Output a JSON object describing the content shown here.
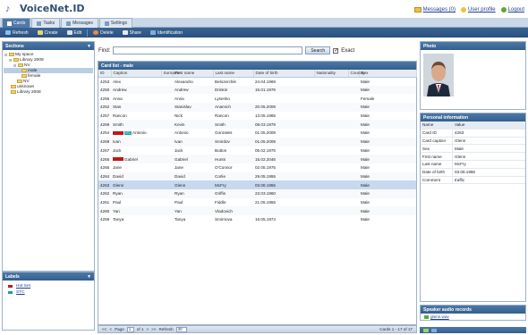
{
  "app": {
    "name": "VoiceNet.ID"
  },
  "userlinks": {
    "messages": "Messages (0)",
    "profile": "User profile",
    "logout": "Logout"
  },
  "tabs": [
    {
      "label": "Cards"
    },
    {
      "label": "Tasks"
    },
    {
      "label": "Messages"
    },
    {
      "label": "Settings"
    }
  ],
  "toolbar": {
    "refresh": "Refresh",
    "create": "Create",
    "edit": "Edit",
    "delete": "Delete",
    "share": "Share",
    "identification": "Identification"
  },
  "sections": {
    "title": "Sections",
    "tree": [
      {
        "label": "My space",
        "level": 0
      },
      {
        "label": "Library 2009",
        "level": 1
      },
      {
        "label": "NV",
        "level": 2
      },
      {
        "label": "male",
        "level": 3
      },
      {
        "label": "female",
        "level": 3
      },
      {
        "label": "NV",
        "level": 2
      },
      {
        "label": "unknown",
        "level": 1
      },
      {
        "label": "Library 2008",
        "level": 1
      }
    ]
  },
  "labels": {
    "title": "Labels",
    "items": [
      {
        "name": "Hot Set",
        "color": "#c01818"
      },
      {
        "name": "STC",
        "color": "#1d9aa8"
      }
    ]
  },
  "search": {
    "label": "Find:",
    "value": "",
    "button": "Search",
    "exact_label": "Exact"
  },
  "grid": {
    "title": "Card list - male",
    "columns": [
      "ID",
      "Caption",
      "Surname",
      "First name",
      "Last name",
      "Date of birth",
      "Nationality",
      "Country",
      "Sex"
    ],
    "rows": [
      {
        "id": "4253",
        "caption": "Alex",
        "surname": "",
        "first": "Alexandro",
        "last": "Belozerchik",
        "dob": "24.04.1969",
        "nat": "",
        "country": "",
        "sex": "Male"
      },
      {
        "id": "4250",
        "caption": "Andrew",
        "surname": "",
        "first": "Andrew",
        "last": "Drinkin",
        "dob": "15.01.1976",
        "nat": "",
        "country": "",
        "sex": "Male"
      },
      {
        "id": "4256",
        "caption": "Anna",
        "surname": "",
        "first": "Anna",
        "last": "Lysenko",
        "dob": "",
        "nat": "",
        "country": "",
        "sex": "Female"
      },
      {
        "id": "4252",
        "caption": "Stas",
        "surname": "",
        "first": "Stanislav",
        "last": "Anamich",
        "dob": "20.05.2009",
        "nat": "",
        "country": "",
        "sex": "Male"
      },
      {
        "id": "4257",
        "caption": "Rancon",
        "surname": "",
        "first": "Nick",
        "last": "Rancon",
        "dob": "13.05.1965",
        "nat": "",
        "country": "",
        "sex": "Male"
      },
      {
        "id": "4269",
        "caption": "Smith",
        "surname": "",
        "first": "Kevin",
        "last": "Smith",
        "dob": "08.03.1979",
        "nat": "",
        "country": "",
        "sex": "Male"
      },
      {
        "id": "4254",
        "caption": "Antonio",
        "surname": "",
        "first": "Antonio",
        "last": "Gonzales",
        "dob": "01.05.2009",
        "nat": "",
        "country": "",
        "sex": "Male",
        "tag": "red-stc"
      },
      {
        "id": "4268",
        "caption": "Ivan",
        "surname": "",
        "first": "Ivan",
        "last": "Smirdov",
        "dob": "01.05.2009",
        "nat": "",
        "country": "",
        "sex": "Male"
      },
      {
        "id": "4267",
        "caption": "Jack",
        "surname": "",
        "first": "Jack",
        "last": "Button",
        "dob": "05.02.1976",
        "nat": "",
        "country": "",
        "sex": "Male"
      },
      {
        "id": "4265",
        "caption": "Gabriel",
        "surname": "",
        "first": "Gabriel",
        "last": "Hunts",
        "dob": "15.02.2046",
        "nat": "",
        "country": "",
        "sex": "Male",
        "tag": "red"
      },
      {
        "id": "4266",
        "caption": "Jane",
        "surname": "",
        "first": "Jane",
        "last": "O'Connor",
        "dob": "02.05.1975",
        "nat": "",
        "country": "",
        "sex": "Male"
      },
      {
        "id": "4264",
        "caption": "David",
        "surname": "",
        "first": "David",
        "last": "Corlie",
        "dob": "29.05.1955",
        "nat": "",
        "country": "",
        "sex": "Male"
      },
      {
        "id": "4263",
        "caption": "Glenn",
        "surname": "",
        "first": "Glenn",
        "last": "McFry",
        "dob": "03.08.1955",
        "nat": "",
        "country": "",
        "sex": "Male",
        "selected": true
      },
      {
        "id": "4262",
        "caption": "Ryan",
        "surname": "",
        "first": "Ryan",
        "last": "Griffin",
        "dob": "23.03.1960",
        "nat": "",
        "country": "",
        "sex": "Male"
      },
      {
        "id": "4261",
        "caption": "Paul",
        "surname": "",
        "first": "Paul",
        "last": "Fiddle",
        "dob": "21.05.1955",
        "nat": "",
        "country": "",
        "sex": "Male"
      },
      {
        "id": "4260",
        "caption": "Yan",
        "surname": "",
        "first": "Yan",
        "last": "Vladovich",
        "dob": "",
        "nat": "",
        "country": "",
        "sex": "Male"
      },
      {
        "id": "4259",
        "caption": "Tanya",
        "surname": "",
        "first": "Tanya",
        "last": "Smirnova",
        "dob": "16.05.1974",
        "nat": "",
        "country": "",
        "sex": "Male"
      }
    ]
  },
  "pager": {
    "page_label": "Page",
    "page": "1",
    "of": "of 1",
    "refresh_label": "Refresh",
    "refresh_value": "30",
    "status": "Cards 1 - 17 of 17"
  },
  "photo": {
    "title": "Photo"
  },
  "personal": {
    "title": "Personal information",
    "head": {
      "name": "Name",
      "value": "Value"
    },
    "rows": [
      {
        "name": "Card ID",
        "value": "4263"
      },
      {
        "name": "Card caption",
        "value": "Glenn"
      },
      {
        "name": "Sex",
        "value": "Male"
      },
      {
        "name": "First name",
        "value": "Glenn"
      },
      {
        "name": "Last name",
        "value": "McFry"
      },
      {
        "name": "Date of birth",
        "value": "03.08.1955"
      },
      {
        "name": "Comment",
        "value": "traffic"
      }
    ]
  },
  "audio": {
    "title": "Speaker audio records",
    "file": "glenn.wav"
  }
}
